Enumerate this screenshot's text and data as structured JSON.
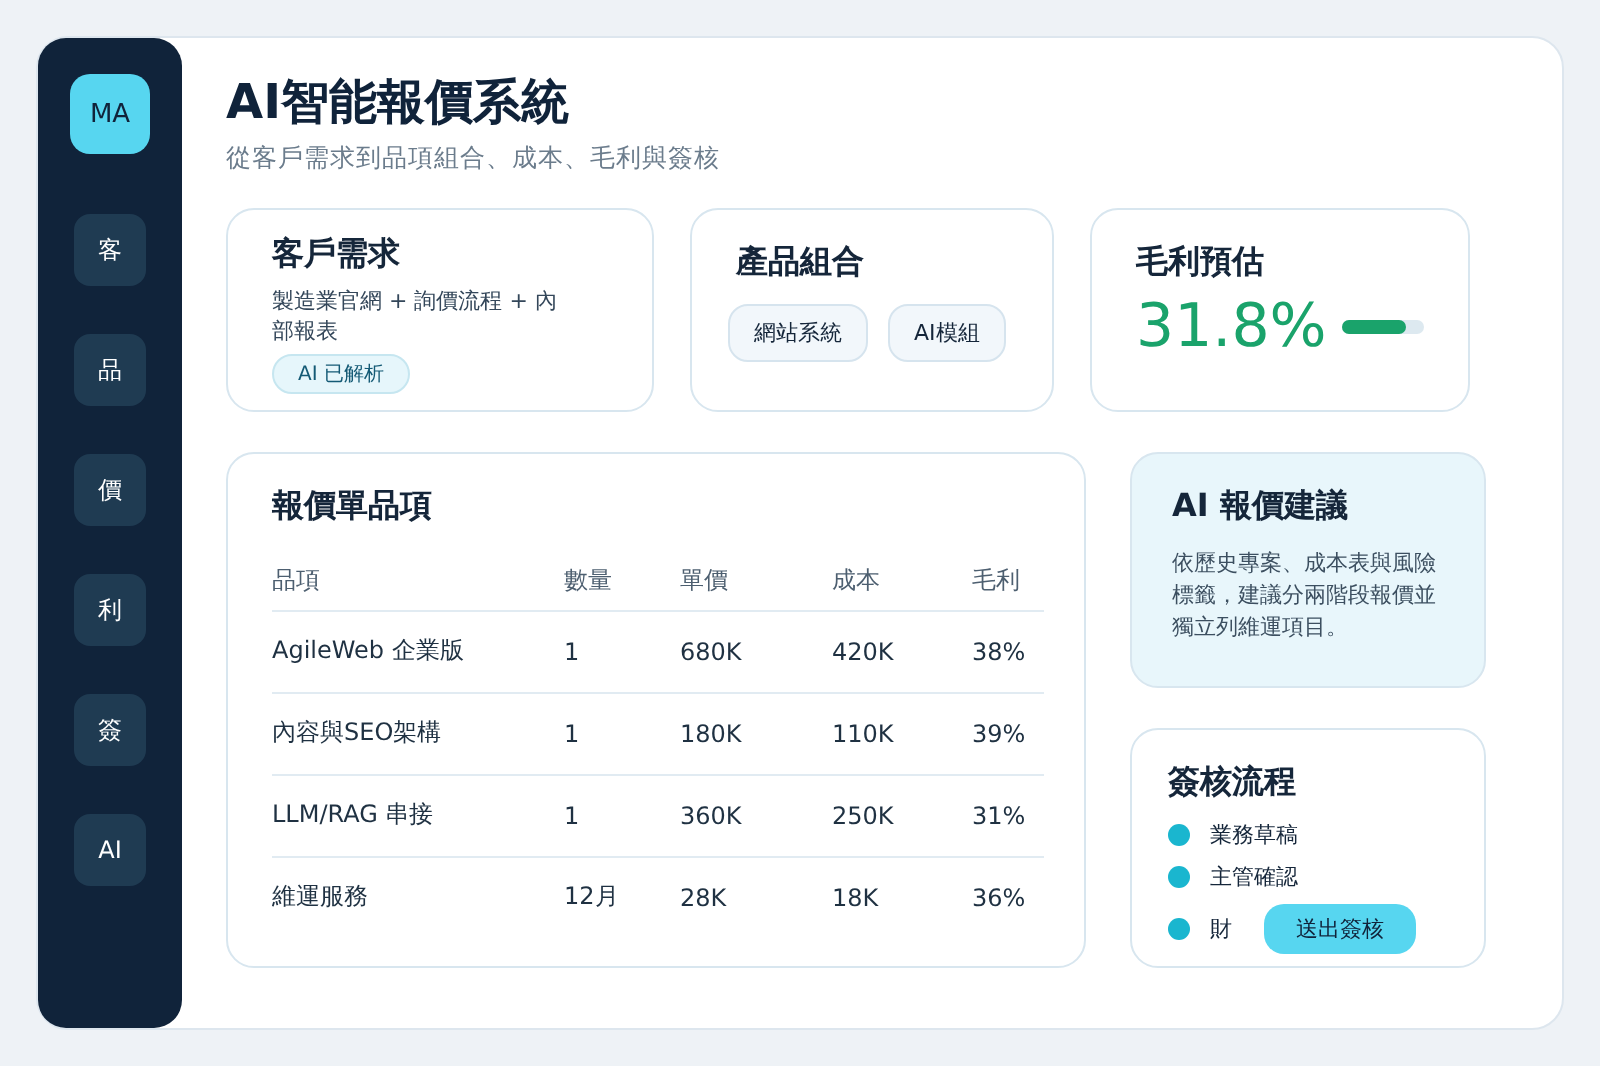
{
  "sidebar": {
    "avatar": "MA",
    "items": [
      {
        "label": "客",
        "selected": false
      },
      {
        "label": "品",
        "selected": false
      },
      {
        "label": "價",
        "selected": false
      },
      {
        "label": "利",
        "selected": false
      },
      {
        "label": "簽",
        "selected": false
      },
      {
        "label": "AI",
        "selected": false
      }
    ]
  },
  "header": {
    "title": "AI智能報價系統",
    "subtitle": "從客戶需求到品項組合、成本、毛利與簽核"
  },
  "requirement": {
    "title": "客戶需求",
    "text": "製造業官網 + 詢價流程 + 內部報表",
    "badge": "AI 已解析"
  },
  "products": {
    "title": "產品組合",
    "chips": [
      "網站系統",
      "AI模組"
    ]
  },
  "margin": {
    "title": "毛利預估",
    "value": "31.8%",
    "level": 0.78
  },
  "quote_table": {
    "title": "報價單品項",
    "columns": [
      "品項",
      "數量",
      "單價",
      "成本",
      "毛利"
    ],
    "rows": [
      [
        "AgileWeb 企業版",
        "1",
        "680K",
        "420K",
        "38%"
      ],
      [
        "內容與SEO架構",
        "1",
        "180K",
        "110K",
        "39%"
      ],
      [
        "LLM/RAG 串接",
        "1",
        "360K",
        "250K",
        "31%"
      ],
      [
        "維運服務",
        "12月",
        "28K",
        "18K",
        "36%"
      ]
    ]
  },
  "ai_suggestion": {
    "title": "AI 報價建議",
    "text": "依歷史專案、成本表與風險標籤，建議分兩階段報價並獨立列維運項目。"
  },
  "approval": {
    "title": "簽核流程",
    "steps": [
      {
        "label": "業務草稿",
        "color": "#1ab6cf"
      },
      {
        "label": "主管確認",
        "color": "#1ab6cf"
      },
      {
        "label": "財",
        "color": "#1ab6cf"
      }
    ],
    "button": "送出簽核"
  }
}
